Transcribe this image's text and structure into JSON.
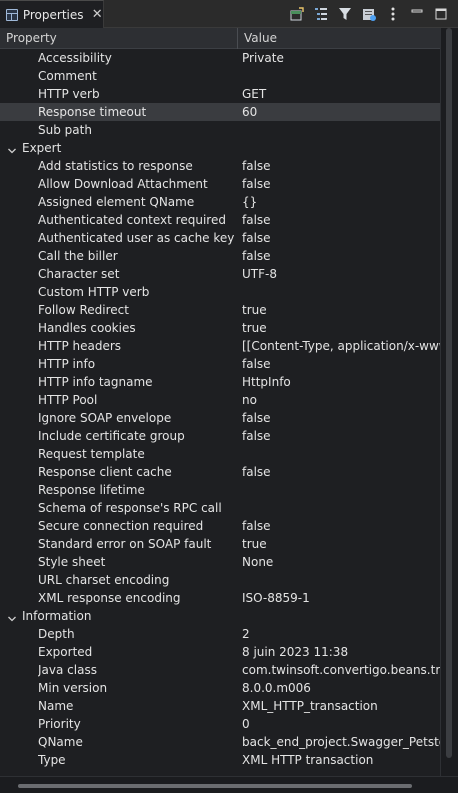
{
  "tab": {
    "title": "Properties"
  },
  "toolbar": {
    "icons": [
      "pin-to-selection-icon",
      "show-categories-icon",
      "filter-icon",
      "show-advanced-icon",
      "view-menu-icon",
      "minimize-icon",
      "maximize-icon"
    ]
  },
  "columns": {
    "property": "Property",
    "value": "Value"
  },
  "rows": [
    {
      "type": "prop",
      "name": "Accessibility",
      "value": "Private"
    },
    {
      "type": "prop",
      "name": "Comment",
      "value": ""
    },
    {
      "type": "prop",
      "name": "HTTP verb",
      "value": "GET"
    },
    {
      "type": "prop",
      "name": "Response timeout",
      "value": "60",
      "selected": true
    },
    {
      "type": "prop",
      "name": "Sub path",
      "value": ""
    },
    {
      "type": "category",
      "name": "Expert",
      "value": ""
    },
    {
      "type": "prop",
      "name": "Add statistics to response",
      "value": "false"
    },
    {
      "type": "prop",
      "name": "Allow Download Attachment",
      "value": "false"
    },
    {
      "type": "prop",
      "name": "Assigned element QName",
      "value": "{}"
    },
    {
      "type": "prop",
      "name": "Authenticated context required",
      "value": "false"
    },
    {
      "type": "prop",
      "name": "Authenticated user as cache key",
      "value": "false"
    },
    {
      "type": "prop",
      "name": "Call the biller",
      "value": "false"
    },
    {
      "type": "prop",
      "name": "Character set",
      "value": "UTF-8"
    },
    {
      "type": "prop",
      "name": "Custom HTTP verb",
      "value": ""
    },
    {
      "type": "prop",
      "name": "Follow Redirect",
      "value": "true"
    },
    {
      "type": "prop",
      "name": "Handles cookies",
      "value": "true"
    },
    {
      "type": "prop",
      "name": "HTTP headers",
      "value": "[[Content-Type, application/x-www-f"
    },
    {
      "type": "prop",
      "name": "HTTP info",
      "value": "false"
    },
    {
      "type": "prop",
      "name": "HTTP info tagname",
      "value": "HttpInfo"
    },
    {
      "type": "prop",
      "name": "HTTP Pool",
      "value": "no"
    },
    {
      "type": "prop",
      "name": "Ignore SOAP envelope",
      "value": "false"
    },
    {
      "type": "prop",
      "name": "Include certificate group",
      "value": "false"
    },
    {
      "type": "prop",
      "name": "Request template",
      "value": ""
    },
    {
      "type": "prop",
      "name": "Response client cache",
      "value": "false"
    },
    {
      "type": "prop",
      "name": "Response lifetime",
      "value": ""
    },
    {
      "type": "prop",
      "name": "Schema of response's RPC call",
      "value": ""
    },
    {
      "type": "prop",
      "name": "Secure connection required",
      "value": "false"
    },
    {
      "type": "prop",
      "name": "Standard error on SOAP fault",
      "value": "true"
    },
    {
      "type": "prop",
      "name": "Style sheet",
      "value": "None"
    },
    {
      "type": "prop",
      "name": "URL charset encoding",
      "value": ""
    },
    {
      "type": "prop",
      "name": "XML response encoding",
      "value": "ISO-8859-1"
    },
    {
      "type": "category",
      "name": "Information",
      "value": ""
    },
    {
      "type": "prop",
      "name": "Depth",
      "value": "2"
    },
    {
      "type": "prop",
      "name": "Exported",
      "value": "8 juin 2023 11:38"
    },
    {
      "type": "prop",
      "name": "Java class",
      "value": "com.twinsoft.convertigo.beans.transa"
    },
    {
      "type": "prop",
      "name": "Min version",
      "value": "8.0.0.m006"
    },
    {
      "type": "prop",
      "name": "Name",
      "value": "XML_HTTP_transaction"
    },
    {
      "type": "prop",
      "name": "Priority",
      "value": "0"
    },
    {
      "type": "prop",
      "name": "QName",
      "value": "back_end_project.Swagger_Petstore_"
    },
    {
      "type": "prop",
      "name": "Type",
      "value": "XML HTTP transaction"
    }
  ],
  "colors": {
    "background": "#1e1f22",
    "selected_row": "#3a3c40",
    "header": "#2d2f33",
    "accent_icon": "#4ea1f3"
  }
}
